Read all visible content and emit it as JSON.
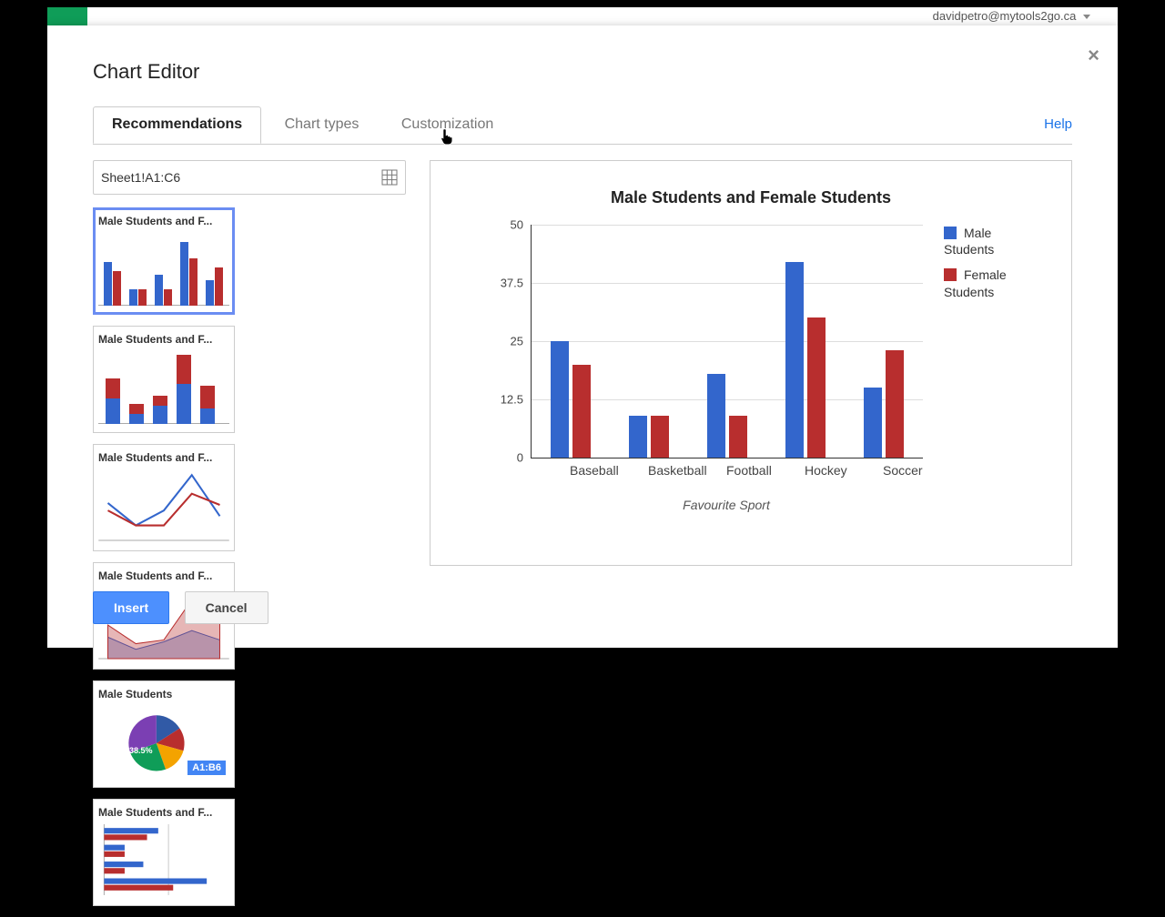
{
  "user_email": "davidpetro@mytools2go.ca",
  "dialog": {
    "title": "Chart Editor",
    "close_label": "×",
    "tabs": {
      "recommendations": "Recommendations",
      "chart_types": "Chart types",
      "customization": "Customization"
    },
    "help_label": "Help",
    "range": "Sheet1!A1:C6",
    "thumbs": [
      {
        "label": "Male Students and F..."
      },
      {
        "label": "Male Students and F..."
      },
      {
        "label": "Male Students and F..."
      },
      {
        "label": "Male Students and F..."
      },
      {
        "label": "Male Students",
        "badge_percent": "38.5%",
        "badge_range": "A1:B6"
      },
      {
        "label": "Male Students and F..."
      }
    ],
    "buttons": {
      "insert": "Insert",
      "cancel": "Cancel"
    }
  },
  "chart_data": {
    "type": "bar",
    "title": "Male Students and Female Students",
    "xlabel": "Favourite Sport",
    "ylabel": "",
    "ylim": [
      0,
      50
    ],
    "yticks": [
      0,
      12.5,
      25,
      37.5,
      50
    ],
    "categories": [
      "Baseball",
      "Basketball",
      "Football",
      "Hockey",
      "Soccer"
    ],
    "series": [
      {
        "name": "Male Students",
        "color": "#3366cc",
        "values": [
          25,
          9,
          18,
          42,
          15
        ]
      },
      {
        "name": "Female Students",
        "color": "#b82e2e",
        "values": [
          20,
          9,
          9,
          30,
          23
        ]
      }
    ]
  }
}
